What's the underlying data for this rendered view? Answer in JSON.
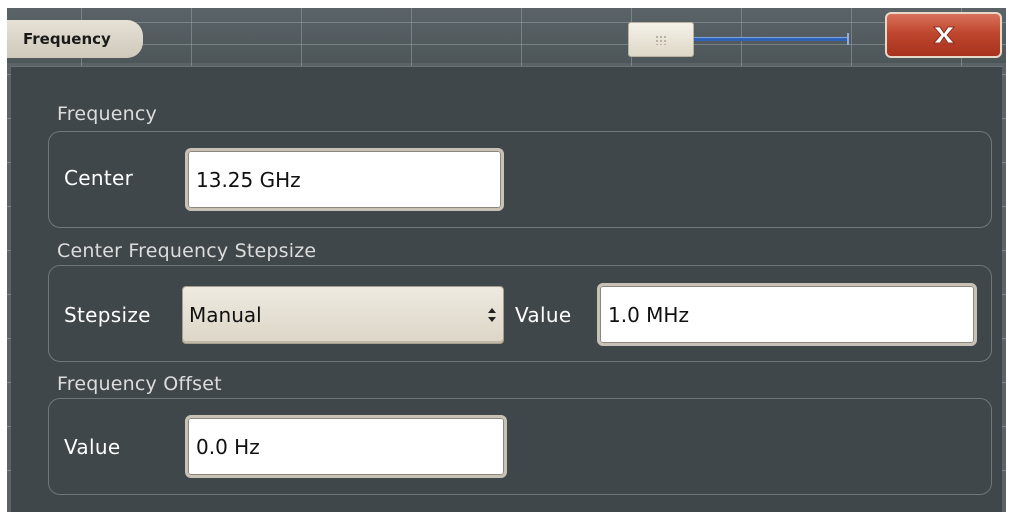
{
  "window": {
    "title": "Frequency",
    "close_label": "X"
  },
  "frequency_section": {
    "title": "Frequency",
    "center_label": "Center",
    "center_value": "13.25 GHz"
  },
  "stepsize_section": {
    "title": "Center Frequency Stepsize",
    "stepsize_label": "Stepsize",
    "stepsize_selected": "Manual",
    "value_label": "Value",
    "value_value": "1.0 MHz"
  },
  "offset_section": {
    "title": "Frequency Offset",
    "value_label": "Value",
    "value_value": "0.0 Hz"
  },
  "icons": {
    "close": "close-icon",
    "select_arrows": "updown-arrows-icon",
    "slider_grip": "grip-icon"
  },
  "colors": {
    "background": "#40474a",
    "close_button": "#c0472f",
    "slider_track": "#2e62b8",
    "label_tab": "#e6e1d5"
  }
}
